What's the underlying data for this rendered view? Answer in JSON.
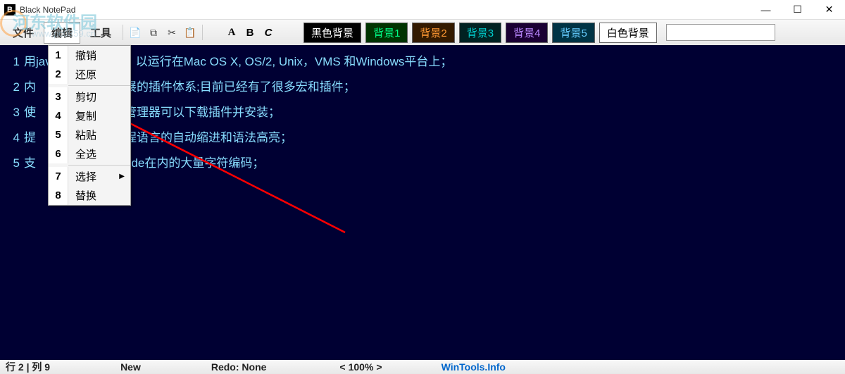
{
  "window": {
    "title": "Black NotePad"
  },
  "watermark": {
    "text": "河东软件园",
    "url": "www.pc0359.cn"
  },
  "menubar": {
    "file": "文件",
    "edit": "编辑",
    "tools": "工具"
  },
  "format": {
    "a": "A",
    "b": "B",
    "c": "C"
  },
  "backgrounds": {
    "black": "黑色背景",
    "bg1": "背景1",
    "bg2": "背景2",
    "bg3": "背景3",
    "bg4": "背景4",
    "bg5": "背景5",
    "white": "白色背景"
  },
  "search": {
    "placeholder": ""
  },
  "dropdown": {
    "items": [
      {
        "num": "1",
        "label": "撤销"
      },
      {
        "num": "2",
        "label": "还原"
      },
      {
        "num": "3",
        "label": "剪切"
      },
      {
        "num": "4",
        "label": "复制"
      },
      {
        "num": "5",
        "label": "粘贴"
      },
      {
        "num": "6",
        "label": "全选"
      },
      {
        "num": "7",
        "label": "选择",
        "submenu": true
      },
      {
        "num": "8",
        "label": "替换"
      }
    ]
  },
  "editor": {
    "lines": [
      {
        "num": "1",
        "text_pre": "用jav",
        "text_post": "以运行在Mac OS X, OS/2, Unix，VMS 和Windows平台上；"
      },
      {
        "num": "2",
        "text_pre": "内",
        "text_post": "展的插件体系;目前已经有了很多宏和插件；"
      },
      {
        "num": "3",
        "text_pre": "使",
        "text_post": "管理器可以下载插件并安装；"
      },
      {
        "num": "4",
        "text_pre": "提",
        "text_post": "程语言的自动缩进和语法高亮；"
      },
      {
        "num": "5",
        "text_pre": "支",
        "text_post": "ode在内的大量字符编码；"
      }
    ]
  },
  "statusbar": {
    "position": "行 2 | 列 9",
    "file_status": "New",
    "redo": "Redo: None",
    "zoom_lt": "<",
    "zoom_val": "100%",
    "zoom_gt": ">",
    "link": "WinTools.Info"
  }
}
